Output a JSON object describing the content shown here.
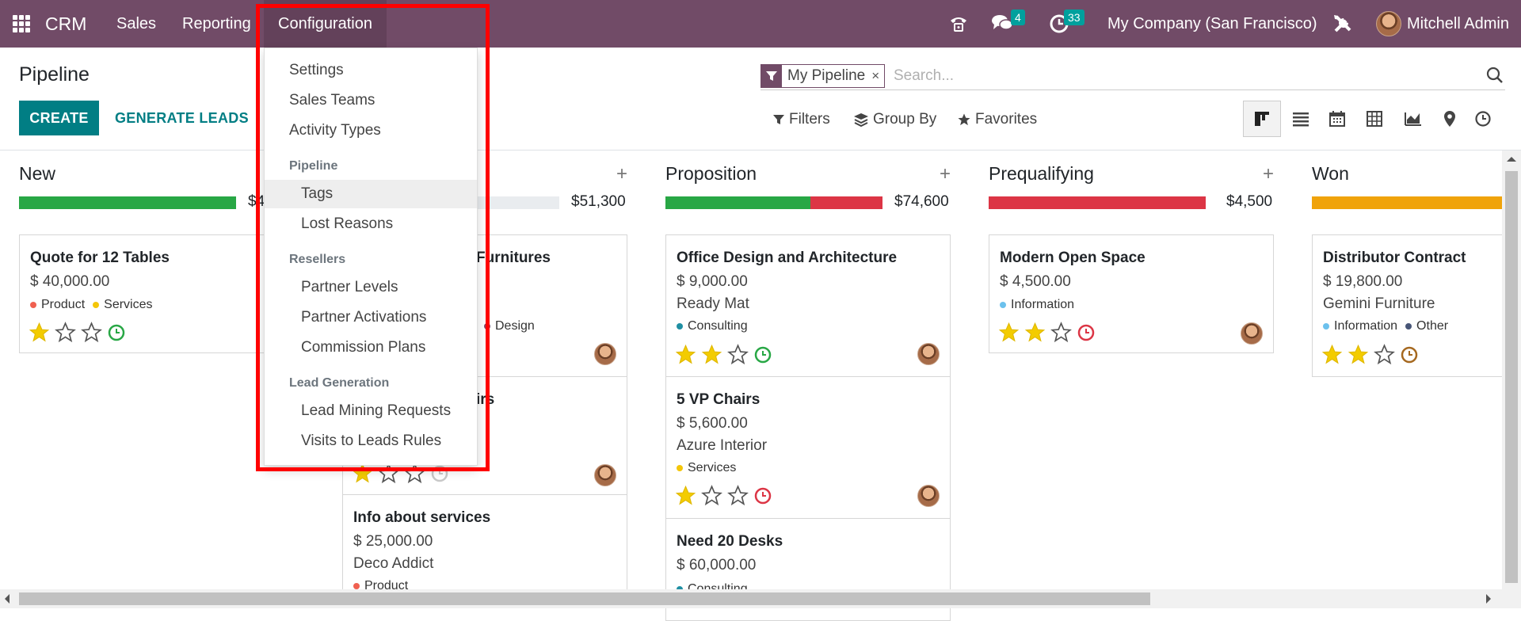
{
  "topbar": {
    "app_name": "CRM",
    "menus": [
      "Sales",
      "Reporting",
      "Configuration"
    ],
    "messages_badge": "4",
    "activities_badge": "33",
    "company": "My Company (San Francisco)",
    "user": "Mitchell Admin",
    "color": "#714b67"
  },
  "control": {
    "title": "Pipeline",
    "create_label": "CREATE",
    "generate_label": "GENERATE LEADS",
    "facet": "My Pipeline",
    "search_placeholder": "Search...",
    "filters": "Filters",
    "group_by": "Group By",
    "favorites": "Favorites",
    "views": [
      "kanban-icon",
      "list-icon",
      "calendar-icon",
      "pivot-icon",
      "graph-icon",
      "map-icon",
      "activity-icon"
    ]
  },
  "columns": [
    {
      "title": "New",
      "amount": "$4…",
      "progress": [
        {
          "color": "#28a745",
          "value": 1.0
        }
      ],
      "cards": [
        {
          "title": "Quote for 12 Tables",
          "amount": "$ 40,000.00",
          "customer": "",
          "tags": [
            {
              "label": "Product",
              "color": "#f06050"
            },
            {
              "label": "Services",
              "color": "#f4c609"
            }
          ],
          "stars": 1,
          "clock": "#28a745",
          "avatar": false
        }
      ]
    },
    {
      "title": "",
      "amount": "$51,300",
      "progress": [
        {
          "color": "#f0a30a",
          "value": 0.3
        }
      ],
      "cards": [
        {
          "title": "Furnitures",
          "amount": "",
          "customer": "",
          "tags": [
            {
              "label": "Design",
              "color": "#814968"
            }
          ],
          "stars": null,
          "clock": null,
          "avatar": true
        },
        {
          "title": "irs",
          "amount": "",
          "customer": "",
          "tags": [],
          "stars": 1,
          "clock": "#c8c8c8",
          "avatar": true
        },
        {
          "title": "Info about services",
          "amount": "$ 25,000.00",
          "customer": "Deco Addict",
          "tags": [
            {
              "label": "Product",
              "color": "#f06050"
            }
          ],
          "stars": null,
          "clock": null,
          "avatar": false
        }
      ]
    },
    {
      "title": "Proposition",
      "amount": "$74,600",
      "progress": [
        {
          "color": "#28a745",
          "value": 0.67
        },
        {
          "color": "#dc3545",
          "value": 0.33
        }
      ],
      "cards": [
        {
          "title": "Office Design and Architecture",
          "amount": "$ 9,000.00",
          "customer": "Ready Mat",
          "tags": [
            {
              "label": "Consulting",
              "color": "#1f8fa3"
            }
          ],
          "stars": 2,
          "clock": "#28a745",
          "avatar": true
        },
        {
          "title": "5 VP Chairs",
          "amount": "$ 5,600.00",
          "customer": "Azure Interior",
          "tags": [
            {
              "label": "Services",
              "color": "#f4c609"
            }
          ],
          "stars": 1,
          "clock": "#dc3545",
          "avatar": true
        },
        {
          "title": "Need 20 Desks",
          "amount": "$ 60,000.00",
          "customer": "",
          "tags": [
            {
              "label": "Consulting",
              "color": "#1f8fa3"
            }
          ],
          "stars": null,
          "clock": null,
          "avatar": false
        }
      ]
    },
    {
      "title": "Prequalifying",
      "amount": "$4,500",
      "progress": [
        {
          "color": "#dc3545",
          "value": 1.0
        }
      ],
      "cards": [
        {
          "title": "Modern Open Space",
          "amount": "$ 4,500.00",
          "customer": "",
          "tags": [
            {
              "label": "Information",
              "color": "#6cc1ed"
            }
          ],
          "stars": 2,
          "clock": "#dc3545",
          "avatar": true
        }
      ]
    },
    {
      "title": "Won",
      "amount": "",
      "progress": [
        {
          "color": "#f0a30a",
          "value": 1.0
        }
      ],
      "cards": [
        {
          "title": "Distributor Contract",
          "amount": "$ 19,800.00",
          "customer": "Gemini Furniture",
          "tags": [
            {
              "label": "Information",
              "color": "#6cc1ed"
            },
            {
              "label": "Other",
              "color": "#475577"
            }
          ],
          "stars": 2,
          "clock": "#a5681f",
          "avatar": false
        }
      ]
    }
  ],
  "config_menu": {
    "items": [
      "Settings",
      "Sales Teams",
      "Activity Types"
    ],
    "pipeline_header": "Pipeline",
    "pipeline_items": [
      "Tags",
      "Lost Reasons"
    ],
    "resellers_header": "Resellers",
    "resellers_items": [
      "Partner Levels",
      "Partner Activations",
      "Commission Plans"
    ],
    "leadgen_header": "Lead Generation",
    "leadgen_items": [
      "Lead Mining Requests",
      "Visits to Leads Rules"
    ],
    "highlight_color": "#ff0000"
  }
}
